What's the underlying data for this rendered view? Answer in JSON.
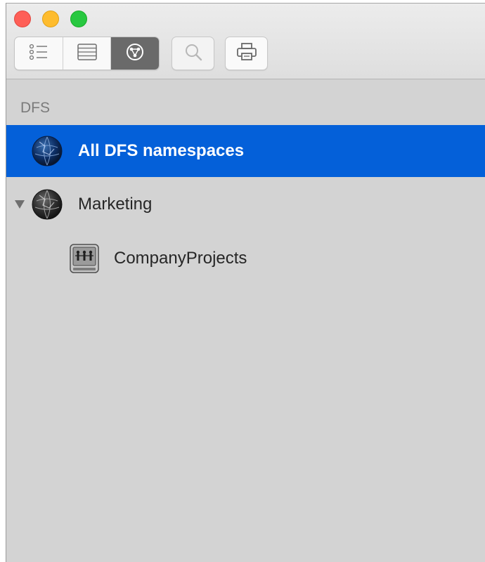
{
  "window": {
    "traffic_lights": [
      "close",
      "minimize",
      "zoom"
    ],
    "toolbar": {
      "view_segments": [
        {
          "icon": "list-view-icon",
          "active": false
        },
        {
          "icon": "column-view-icon",
          "active": false
        },
        {
          "icon": "dfs-view-icon",
          "active": true
        }
      ],
      "search_icon": "search-icon",
      "print_icon": "print-icon"
    }
  },
  "sidebar": {
    "section_header": "DFS",
    "items": [
      {
        "label": "All DFS namespaces",
        "icon": "globe-icon",
        "selected": true,
        "level": 0
      },
      {
        "label": "Marketing",
        "icon": "globe-icon",
        "expanded": true,
        "level": 0
      },
      {
        "label": "CompanyProjects",
        "icon": "file-server-icon",
        "level": 1
      }
    ]
  },
  "colors": {
    "selection": "#0460d9",
    "sidebar_bg": "#d3d3d3",
    "section_header": "#7b7b7b"
  }
}
